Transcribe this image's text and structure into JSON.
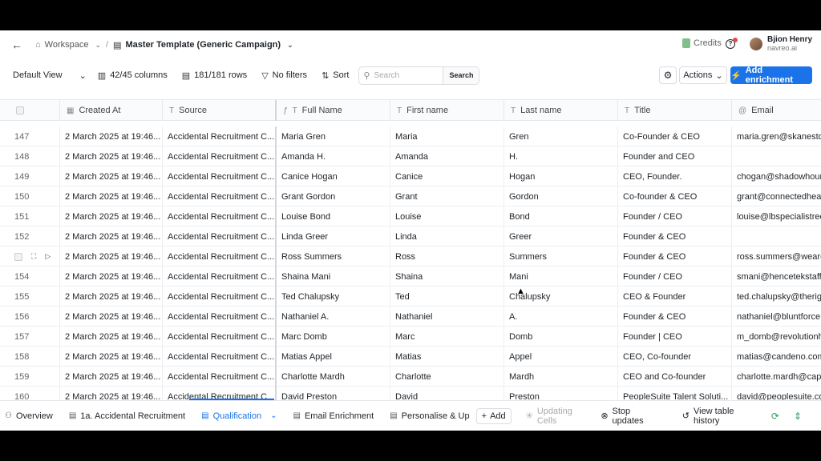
{
  "header": {
    "workspace": "Workspace",
    "template": "Master Template (Generic Campaign)",
    "credits": "Credits",
    "user_name": "Bjion Henry",
    "user_org": "navreo.ai"
  },
  "toolbar": {
    "view": "Default View",
    "columns": "42/45 columns",
    "rows": "181/181 rows",
    "filters": "No filters",
    "sort": "Sort",
    "search_placeholder": "Search",
    "search_button": "Search",
    "actions": "Actions",
    "add_enrichment": "Add enrichment"
  },
  "table": {
    "headers": [
      "Created At",
      "Source",
      "Full Name",
      "First name",
      "Last name",
      "Title",
      "Email"
    ],
    "rows": [
      [
        "147",
        "2 March 2025 at 19:46...",
        "Accidental Recruitment C...",
        "Maria Gren",
        "Maria",
        "Gren",
        "Co-Founder & CEO",
        "maria.gren@skanesto"
      ],
      [
        "148",
        "2 March 2025 at 19:46...",
        "Accidental Recruitment C...",
        "Amanda H.",
        "Amanda",
        "H.",
        "Founder and CEO",
        ""
      ],
      [
        "149",
        "2 March 2025 at 19:46...",
        "Accidental Recruitment C...",
        "Canice Hogan",
        "Canice",
        "Hogan",
        "CEO, Founder.",
        "chogan@shadowhoun"
      ],
      [
        "150",
        "2 March 2025 at 19:46...",
        "Accidental Recruitment C...",
        "Grant Gordon",
        "Grant",
        "Gordon",
        "Co-founder & CEO",
        "grant@connectedheal"
      ],
      [
        "151",
        "2 March 2025 at 19:46...",
        "Accidental Recruitment C...",
        "Louise Bond",
        "Louise",
        "Bond",
        "Founder / CEO",
        "louise@lbspecialistrec"
      ],
      [
        "152",
        "2 March 2025 at 19:46...",
        "Accidental Recruitment C...",
        "Linda Greer",
        "Linda",
        "Greer",
        "Founder & CEO",
        ""
      ],
      [
        "",
        "2 March 2025 at 19:46...",
        "Accidental Recruitment C...",
        "Ross Summers",
        "Ross",
        "Summers",
        "Founder & CEO",
        "ross.summers@weare"
      ],
      [
        "154",
        "2 March 2025 at 19:46...",
        "Accidental Recruitment C...",
        "Shaina Mani",
        "Shaina",
        "Mani",
        "Founder / CEO",
        "smani@hencetekstaffi"
      ],
      [
        "155",
        "2 March 2025 at 19:46...",
        "Accidental Recruitment C...",
        "Ted Chalupsky",
        "Ted",
        "Chalupsky",
        "CEO & Founder",
        "ted.chalupsky@therigh"
      ],
      [
        "156",
        "2 March 2025 at 19:46...",
        "Accidental Recruitment C...",
        "Nathaniel A.",
        "Nathaniel",
        "A.",
        "Founder & CEO",
        "nathaniel@bluntforce."
      ],
      [
        "157",
        "2 March 2025 at 19:46...",
        "Accidental Recruitment C...",
        "Marc Domb",
        "Marc",
        "Domb",
        "Founder | CEO",
        "m_domb@revolutionhe"
      ],
      [
        "158",
        "2 March 2025 at 19:46...",
        "Accidental Recruitment C...",
        "Matias Appel",
        "Matias",
        "Appel",
        "CEO, Co-founder",
        "matias@candeno.com"
      ],
      [
        "159",
        "2 March 2025 at 19:46...",
        "Accidental Recruitment C...",
        "Charlotte Mardh",
        "Charlotte",
        "Mardh",
        "CEO and Co-founder",
        "charlotte.mardh@capa"
      ],
      [
        "160",
        "2 March 2025 at 19:46...",
        "Accidental Recruitment C...",
        "David Preston",
        "David",
        "Preston",
        "PeopleSuite Talent Soluti...",
        "david@peoplesuite.com"
      ]
    ]
  },
  "bottom": {
    "tabs": [
      "Overview",
      "1a. Accidental Recruitment",
      "Qualification",
      "Email Enrichment",
      "Personalise & Up"
    ],
    "add": "Add",
    "updating": "Updating Cells",
    "stop": "Stop updates",
    "history": "View table history"
  },
  "colors": {
    "accent": "#1a73e8",
    "green": "#2e9e5e"
  }
}
